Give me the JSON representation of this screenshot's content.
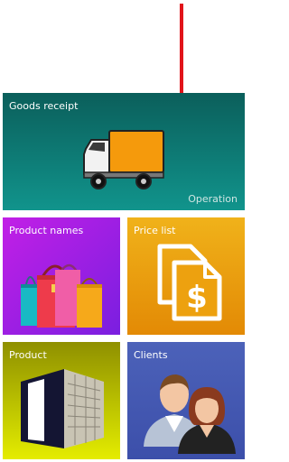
{
  "tiles": {
    "goods_receipt": {
      "title": "Goods receipt",
      "subtitle": "Operation",
      "icon": "truck-icon"
    },
    "product_names": {
      "title": "Product names",
      "icon": "shopping-bags-icon"
    },
    "price_list": {
      "title": "Price list",
      "icon": "price-documents-icon"
    },
    "product": {
      "title": "Product",
      "icon": "building-icon"
    },
    "clients": {
      "title": "Clients",
      "icon": "people-icon"
    }
  },
  "colors": {
    "goods_receipt": "#0e7e78",
    "product_names": "#a51ee6",
    "price_list": "#e9a00f",
    "product": "#b6bd00",
    "clients": "#4558b2",
    "pointer_arrow": "#e1141a"
  }
}
